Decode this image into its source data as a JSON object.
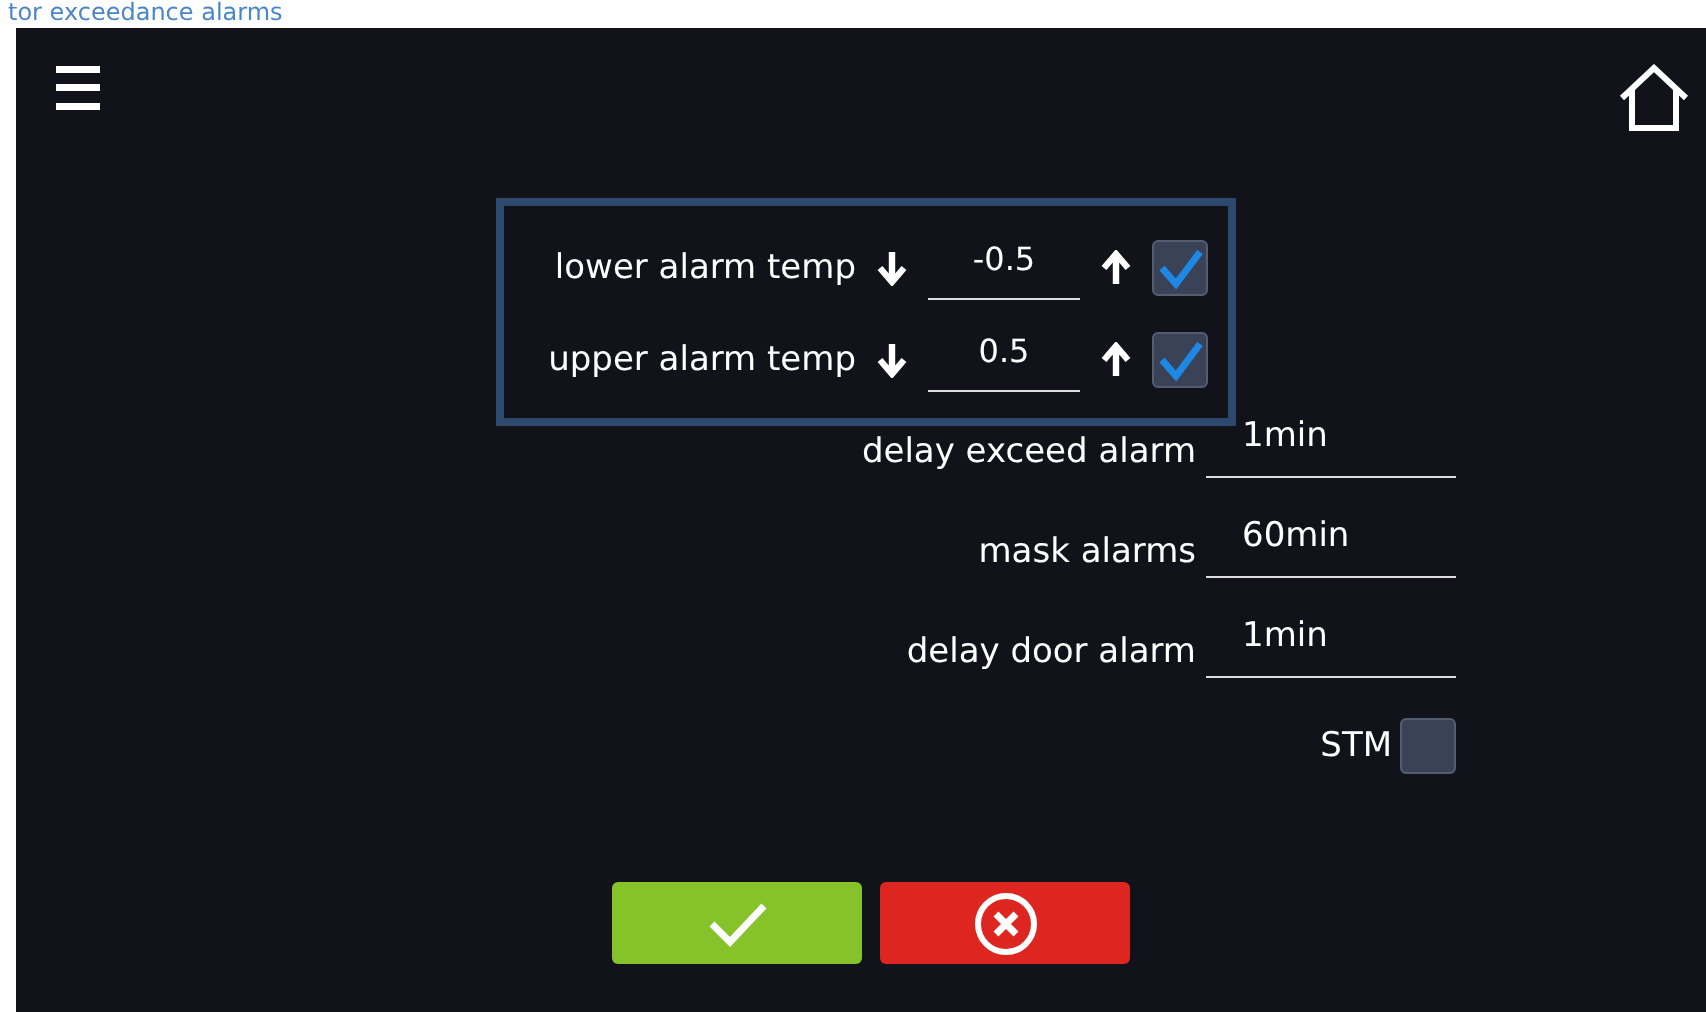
{
  "header": {
    "title": "tor exceedance alarms"
  },
  "alarm_limits": [
    {
      "label": "lower alarm temp",
      "value": "-0.5",
      "checked": true
    },
    {
      "label": "upper alarm temp",
      "value": "0.5",
      "checked": true
    }
  ],
  "settings": [
    {
      "label": "delay exceed alarm",
      "value": "1min"
    },
    {
      "label": "mask alarms",
      "value": "60min"
    },
    {
      "label": "delay door alarm",
      "value": "1min"
    }
  ],
  "stm": {
    "label": "STM",
    "checked": false
  },
  "buttons": [
    {
      "kind": "confirm"
    },
    {
      "kind": "cancel"
    }
  ]
}
